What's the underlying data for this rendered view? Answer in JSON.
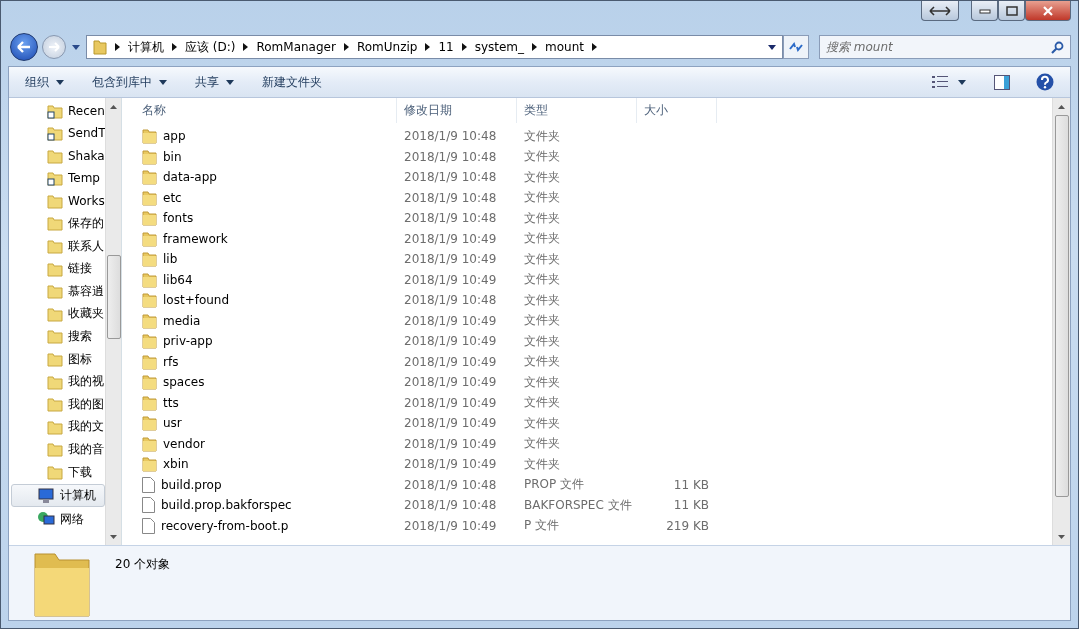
{
  "breadcrumb": [
    "计算机",
    "应该 (D:)",
    "RomManager",
    "RomUnzip",
    "11",
    "system_",
    "mount"
  ],
  "search": {
    "placeholder": "搜索 mount"
  },
  "toolbar": [
    {
      "label": "组织",
      "dropdown": true
    },
    {
      "label": "包含到库中",
      "dropdown": true
    },
    {
      "label": "共享",
      "dropdown": true
    },
    {
      "label": "新建文件夹",
      "dropdown": false
    }
  ],
  "sidebar": {
    "items": [
      {
        "label": "Recen",
        "kind": "shortcut",
        "selected": false
      },
      {
        "label": "SendT",
        "kind": "shortcut",
        "selected": false
      },
      {
        "label": "Shaka",
        "kind": "folder",
        "selected": false
      },
      {
        "label": "Temp",
        "kind": "shortcut",
        "selected": false
      },
      {
        "label": "Works",
        "kind": "folder",
        "selected": false
      },
      {
        "label": "保存的",
        "kind": "folder",
        "selected": false
      },
      {
        "label": "联系人",
        "kind": "folder",
        "selected": false
      },
      {
        "label": "链接",
        "kind": "folder",
        "selected": false
      },
      {
        "label": "慕容逍",
        "kind": "folder",
        "selected": false
      },
      {
        "label": "收藏夹",
        "kind": "folder",
        "selected": false
      },
      {
        "label": "搜索",
        "kind": "folder",
        "selected": false
      },
      {
        "label": "图标",
        "kind": "folder",
        "selected": false
      },
      {
        "label": "我的视",
        "kind": "folder",
        "selected": false
      },
      {
        "label": "我的图",
        "kind": "folder",
        "selected": false
      },
      {
        "label": "我的文",
        "kind": "folder",
        "selected": false
      },
      {
        "label": "我的音",
        "kind": "folder",
        "selected": false
      },
      {
        "label": "下载",
        "kind": "folder",
        "selected": false
      },
      {
        "label": "计算机",
        "kind": "computer",
        "selected": true
      },
      {
        "label": "网络",
        "kind": "network",
        "selected": false
      }
    ]
  },
  "table": {
    "columns": [
      "名称",
      "修改日期",
      "类型",
      "大小"
    ],
    "rows": [
      {
        "name": "app",
        "date": "2018/1/9 10:48",
        "type": "文件夹",
        "kind": "folder"
      },
      {
        "name": "bin",
        "date": "2018/1/9 10:48",
        "type": "文件夹",
        "kind": "folder"
      },
      {
        "name": "data-app",
        "date": "2018/1/9 10:48",
        "type": "文件夹",
        "kind": "folder"
      },
      {
        "name": "etc",
        "date": "2018/1/9 10:48",
        "type": "文件夹",
        "kind": "folder"
      },
      {
        "name": "fonts",
        "date": "2018/1/9 10:48",
        "type": "文件夹",
        "kind": "folder"
      },
      {
        "name": "framework",
        "date": "2018/1/9 10:49",
        "type": "文件夹",
        "kind": "folder"
      },
      {
        "name": "lib",
        "date": "2018/1/9 10:49",
        "type": "文件夹",
        "kind": "folder"
      },
      {
        "name": "lib64",
        "date": "2018/1/9 10:49",
        "type": "文件夹",
        "kind": "folder"
      },
      {
        "name": "lost+found",
        "date": "2018/1/9 10:48",
        "type": "文件夹",
        "kind": "folder"
      },
      {
        "name": "media",
        "date": "2018/1/9 10:49",
        "type": "文件夹",
        "kind": "folder"
      },
      {
        "name": "priv-app",
        "date": "2018/1/9 10:49",
        "type": "文件夹",
        "kind": "folder"
      },
      {
        "name": "rfs",
        "date": "2018/1/9 10:49",
        "type": "文件夹",
        "kind": "folder"
      },
      {
        "name": "spaces",
        "date": "2018/1/9 10:49",
        "type": "文件夹",
        "kind": "folder"
      },
      {
        "name": "tts",
        "date": "2018/1/9 10:49",
        "type": "文件夹",
        "kind": "folder"
      },
      {
        "name": "usr",
        "date": "2018/1/9 10:49",
        "type": "文件夹",
        "kind": "folder"
      },
      {
        "name": "vendor",
        "date": "2018/1/9 10:49",
        "type": "文件夹",
        "kind": "folder"
      },
      {
        "name": "xbin",
        "date": "2018/1/9 10:49",
        "type": "文件夹",
        "kind": "folder"
      },
      {
        "name": "build.prop",
        "date": "2018/1/9 10:48",
        "type": "PROP 文件",
        "size": "11 KB",
        "kind": "file"
      },
      {
        "name": "build.prop.bakforspec",
        "date": "2018/1/9 10:48",
        "type": "BAKFORSPEC 文件",
        "size": "11 KB",
        "kind": "file"
      },
      {
        "name": "recovery-from-boot.p",
        "date": "2018/1/9 10:49",
        "type": "P 文件",
        "size": "219 KB",
        "kind": "file"
      }
    ]
  },
  "status_bar": {
    "count": "20 个对象"
  }
}
